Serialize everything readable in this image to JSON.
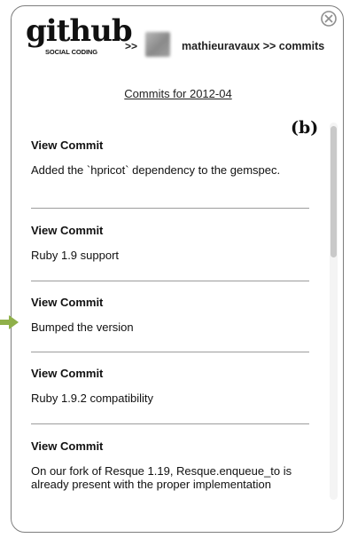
{
  "header": {
    "logo_text": "github",
    "logo_tagline": "SOCIAL CODING",
    "separator": ">>",
    "user_breadcrumb": "mathieuravaux >> commits"
  },
  "page": {
    "title": "Commits for 2012-04",
    "figure_label": "(b)"
  },
  "commits": [
    {
      "link_label": "View Commit",
      "message": "Added the `hpricot` dependency to the gemspec."
    },
    {
      "link_label": "View Commit",
      "message": "Ruby 1.9 support"
    },
    {
      "link_label": "View Commit",
      "message": "Bumped the version"
    },
    {
      "link_label": "View Commit",
      "message": "Ruby 1.9.2 compatibility"
    },
    {
      "link_label": "View Commit",
      "message": "On our fork of Resque 1.19, Resque.enqueue_to is already present with the proper implementation"
    }
  ],
  "icons": {
    "close": "close-icon",
    "arrow": "arrow-right-icon"
  },
  "colors": {
    "arrow": "#8fb04a",
    "panel_border": "#7d7d7d",
    "divider": "#9c9c9c"
  }
}
